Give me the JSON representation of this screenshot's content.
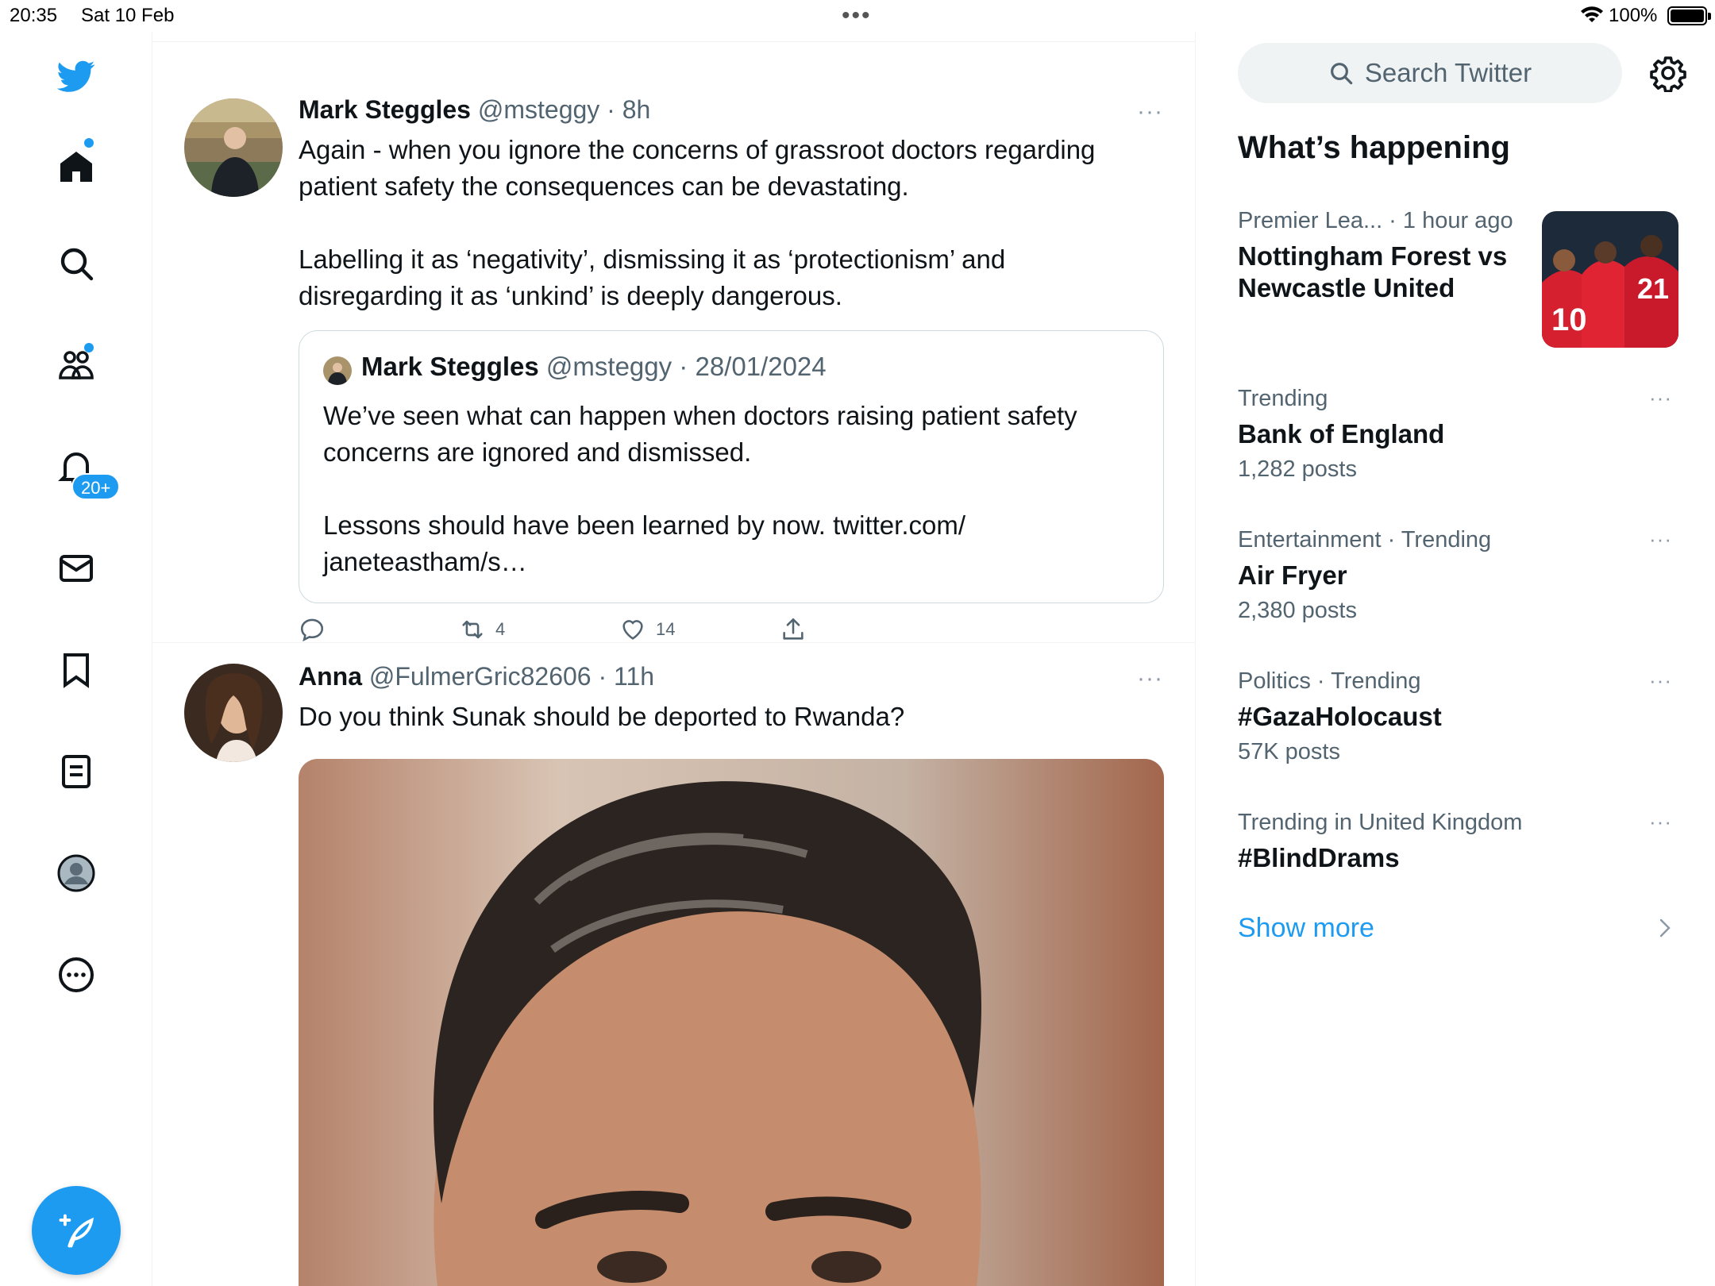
{
  "status_bar": {
    "time": "20:35",
    "date": "Sat 10 Feb",
    "battery": "100%",
    "battery_level": 1.0
  },
  "nav": {
    "notifications_badge": "20+",
    "icons": [
      "twitter-logo-icon",
      "home-icon",
      "search-icon",
      "communities-icon",
      "notifications-icon",
      "messages-icon",
      "bookmarks-icon",
      "lists-icon",
      "profile-icon",
      "more-icon",
      "compose-icon"
    ]
  },
  "colors": {
    "accent": "#1d9bf0",
    "text_primary": "#0f1419",
    "text_secondary": "#536471",
    "border": "#eff3f4"
  },
  "feed": {
    "tweets": [
      {
        "name": "Mark Steggles",
        "meta": "@msteggy · 8h",
        "text": "Again - when you ignore the concerns of grassroot doctors regarding patient safety the consequences can be devastating.\n\nLabelling it as ‘negativity’, dismissing it as ‘protectionism’ and disregarding it as ‘unkind’ is deeply dangerous.",
        "quote": {
          "name": "Mark Steggles",
          "meta": "@msteggy · 28/01/2024",
          "text": "We’ve seen what can happen when doctors raising patient safety concerns are ignored and dismissed.\n\nLessons should have been learned by now. twitter.com/\njaneteastham/s…"
        },
        "retweets": "4",
        "likes": "14",
        "more": "···"
      },
      {
        "name": "Anna",
        "meta": "@FulmerGric82606 · 11h",
        "text": "Do you think Sunak should be deported to Rwanda?",
        "more": "···"
      }
    ]
  },
  "sidebar": {
    "search_placeholder": "Search Twitter",
    "title": "What’s happening",
    "trends": [
      {
        "context": "Premier Lea... · 1 hour ago",
        "topic": "Nottingham Forest vs\nNewcastle United",
        "count": ""
      },
      {
        "context": "Trending",
        "topic": "Bank of England",
        "count": "1,282 posts"
      },
      {
        "context": "Entertainment · Trending",
        "topic": "Air Fryer",
        "count": "2,380 posts"
      },
      {
        "context": "Politics · Trending",
        "topic": "#GazaHolocaust",
        "count": "57K posts"
      },
      {
        "context": "Trending in United Kingdom",
        "topic": "#BlindDrams",
        "count": ""
      }
    ],
    "more_label": "···",
    "show_more": "Show more"
  }
}
